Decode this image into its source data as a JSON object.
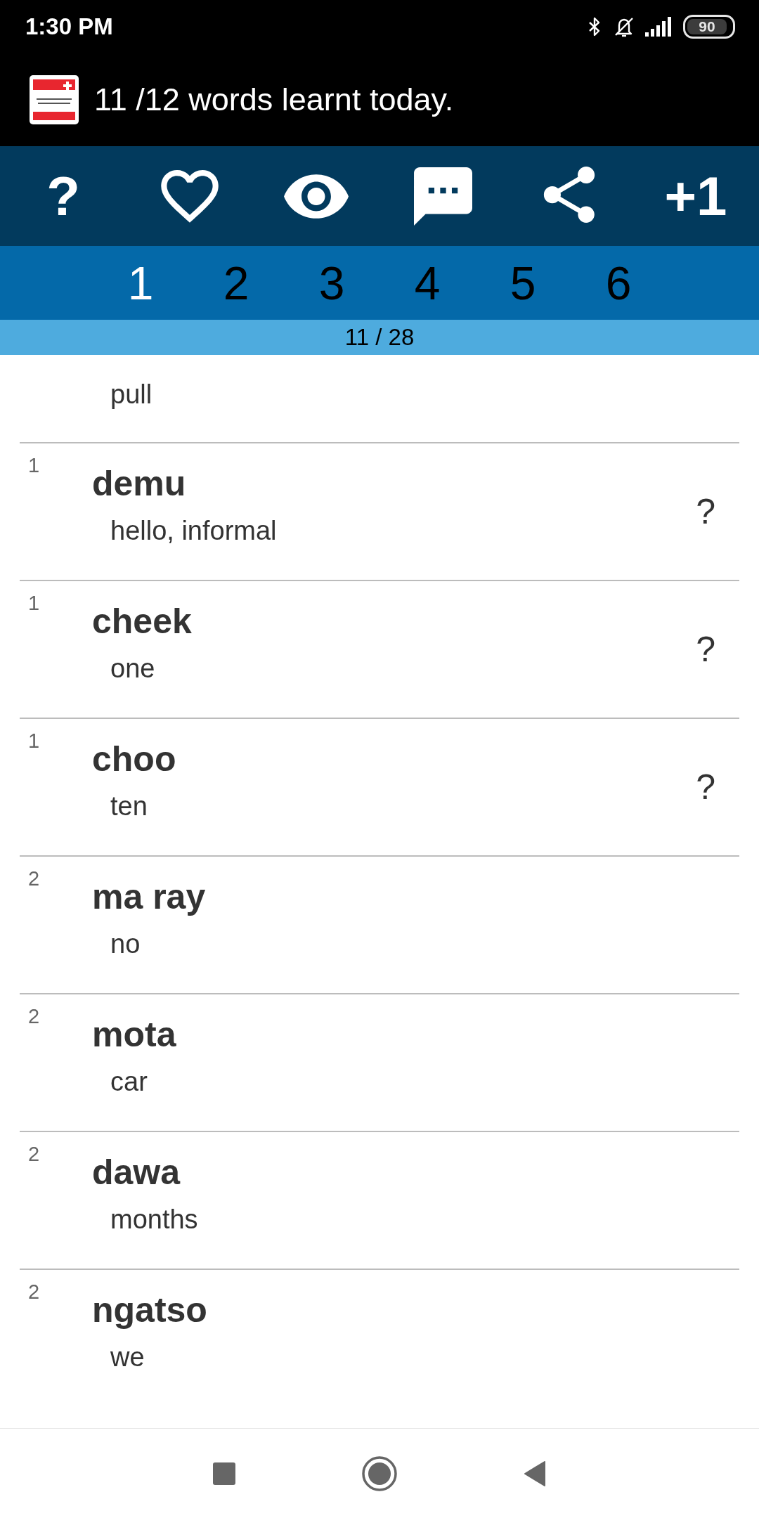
{
  "status_bar": {
    "time": "1:30 PM",
    "battery": "90"
  },
  "app_bar": {
    "title": "11 /12 words learnt today."
  },
  "toolbar": [
    {
      "kind": "text",
      "label": "?"
    },
    {
      "kind": "icon"
    },
    {
      "kind": "icon"
    },
    {
      "kind": "icon"
    },
    {
      "kind": "icon"
    },
    {
      "kind": "text",
      "label": "+1"
    }
  ],
  "tabs": [
    {
      "label": "1",
      "selected": true
    },
    {
      "label": "2",
      "selected": false
    },
    {
      "label": "3",
      "selected": false
    },
    {
      "label": "4",
      "selected": false
    },
    {
      "label": "5",
      "selected": false
    },
    {
      "label": "6",
      "selected": false
    }
  ],
  "progress": {
    "text": "11 / 28"
  },
  "words": [
    {
      "meaning": "pull"
    },
    {
      "number": "1",
      "word": "demu",
      "meaning": "hello, informal",
      "mark": "?"
    },
    {
      "number": "1",
      "word": "cheek",
      "meaning": "one",
      "mark": "?"
    },
    {
      "number": "1",
      "word": "choo",
      "meaning": "ten",
      "mark": "?"
    },
    {
      "number": "2",
      "word": "ma ray",
      "meaning": "no"
    },
    {
      "number": "2",
      "word": "mota",
      "meaning": "car"
    },
    {
      "number": "2",
      "word": "dawa",
      "meaning": "months"
    },
    {
      "number": "2",
      "word": "ngatso",
      "meaning": "we"
    }
  ]
}
